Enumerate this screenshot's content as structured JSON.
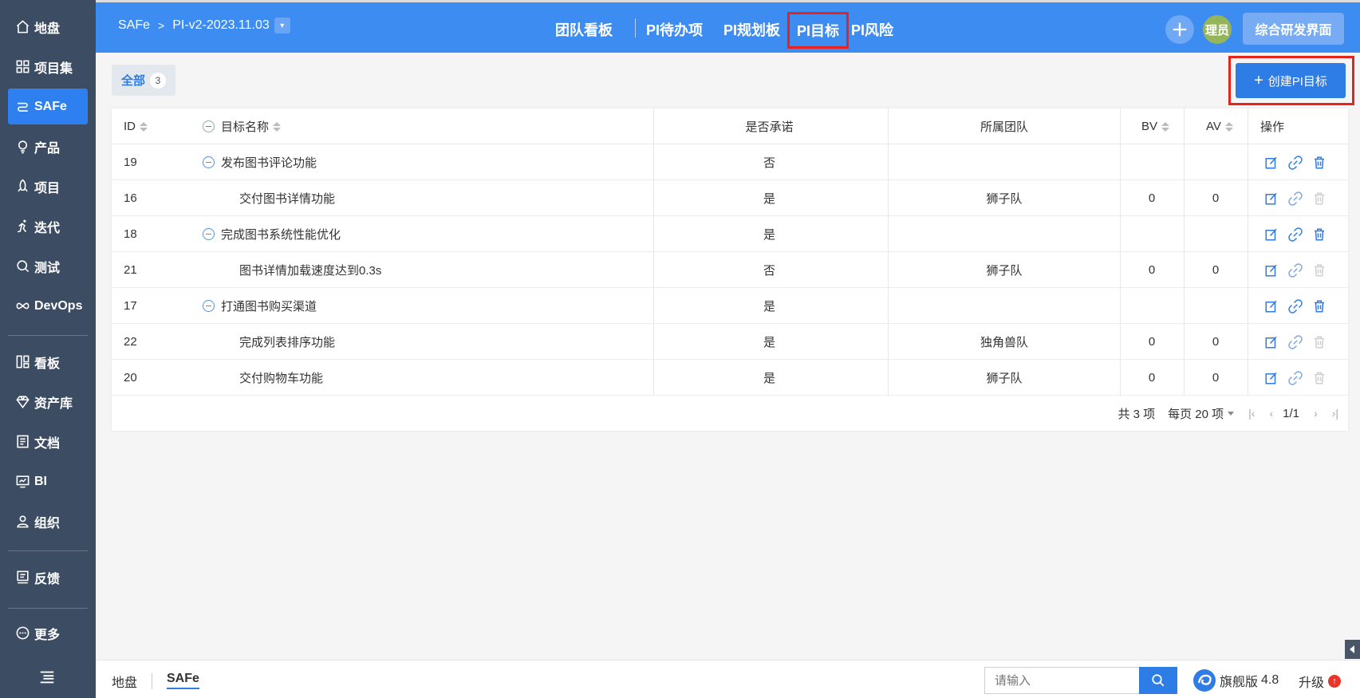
{
  "sidebar": {
    "items": [
      {
        "label": "地盘",
        "icon": "home-icon"
      },
      {
        "label": "项目集",
        "icon": "grid-icon"
      },
      {
        "label": "SAFe",
        "icon": "safe-icon",
        "active": true
      },
      {
        "label": "产品",
        "icon": "lightbulb-icon"
      },
      {
        "label": "项目",
        "icon": "rocket-icon"
      },
      {
        "label": "迭代",
        "icon": "runner-icon"
      },
      {
        "label": "测试",
        "icon": "magnifier-icon"
      },
      {
        "label": "DevOps",
        "icon": "infinity-icon"
      },
      {
        "label": "看板",
        "icon": "kanban-icon"
      },
      {
        "label": "资产库",
        "icon": "diamond-icon"
      },
      {
        "label": "文档",
        "icon": "document-icon"
      },
      {
        "label": "BI",
        "icon": "monitor-icon"
      },
      {
        "label": "组织",
        "icon": "user-icon"
      },
      {
        "label": "反馈",
        "icon": "feedback-icon"
      },
      {
        "label": "更多",
        "icon": "more-icon"
      }
    ]
  },
  "header": {
    "breadcrumb_root": "SAFe",
    "breadcrumb_sep": ">",
    "breadcrumb_current": "PI-v2-2023.11.03",
    "nav": [
      "团队看板",
      "PI待办项",
      "PI规划板",
      "PI目标",
      "PI风险"
    ],
    "active_nav": "PI目标",
    "avatar_text": "理员",
    "action_button": "综合研发界面"
  },
  "toolbar": {
    "filter_label": "全部",
    "filter_count": "3",
    "create_label": "创建PI目标"
  },
  "table": {
    "columns": {
      "id": "ID",
      "name": "目标名称",
      "committed": "是否承诺",
      "team": "所属团队",
      "bv": "BV",
      "av": "AV",
      "ops": "操作"
    },
    "rows": [
      {
        "id": "19",
        "name": "发布图书评论功能",
        "parent": true,
        "committed": "否",
        "team": "",
        "bv": "",
        "av": ""
      },
      {
        "id": "16",
        "name": "交付图书详情功能",
        "parent": false,
        "committed": "是",
        "team": "狮子队",
        "bv": "0",
        "av": "0"
      },
      {
        "id": "18",
        "name": "完成图书系统性能优化",
        "parent": true,
        "committed": "是",
        "team": "",
        "bv": "",
        "av": ""
      },
      {
        "id": "21",
        "name": "图书详情加载速度达到0.3s",
        "parent": false,
        "committed": "否",
        "team": "狮子队",
        "bv": "0",
        "av": "0"
      },
      {
        "id": "17",
        "name": "打通图书购买渠道",
        "parent": true,
        "committed": "是",
        "team": "",
        "bv": "",
        "av": ""
      },
      {
        "id": "22",
        "name": "完成列表排序功能",
        "parent": false,
        "committed": "是",
        "team": "独角兽队",
        "bv": "0",
        "av": "0"
      },
      {
        "id": "20",
        "name": "交付购物车功能",
        "parent": false,
        "committed": "是",
        "team": "狮子队",
        "bv": "0",
        "av": "0"
      }
    ]
  },
  "pager": {
    "total": "共 3 项",
    "per_page": "每页 20 项",
    "page": "1/1"
  },
  "bottom": {
    "tabs": [
      "地盘",
      "SAFe"
    ],
    "active_tab": "SAFe",
    "search_placeholder": "请输入",
    "edition": "旗舰版",
    "version": "4.8",
    "upgrade": "升级"
  },
  "colors": {
    "sidebar_bg": "#3c4c63",
    "header_bg": "#3d8cf2",
    "accent": "#2e7ce6",
    "highlight_border": "#e8231b"
  }
}
